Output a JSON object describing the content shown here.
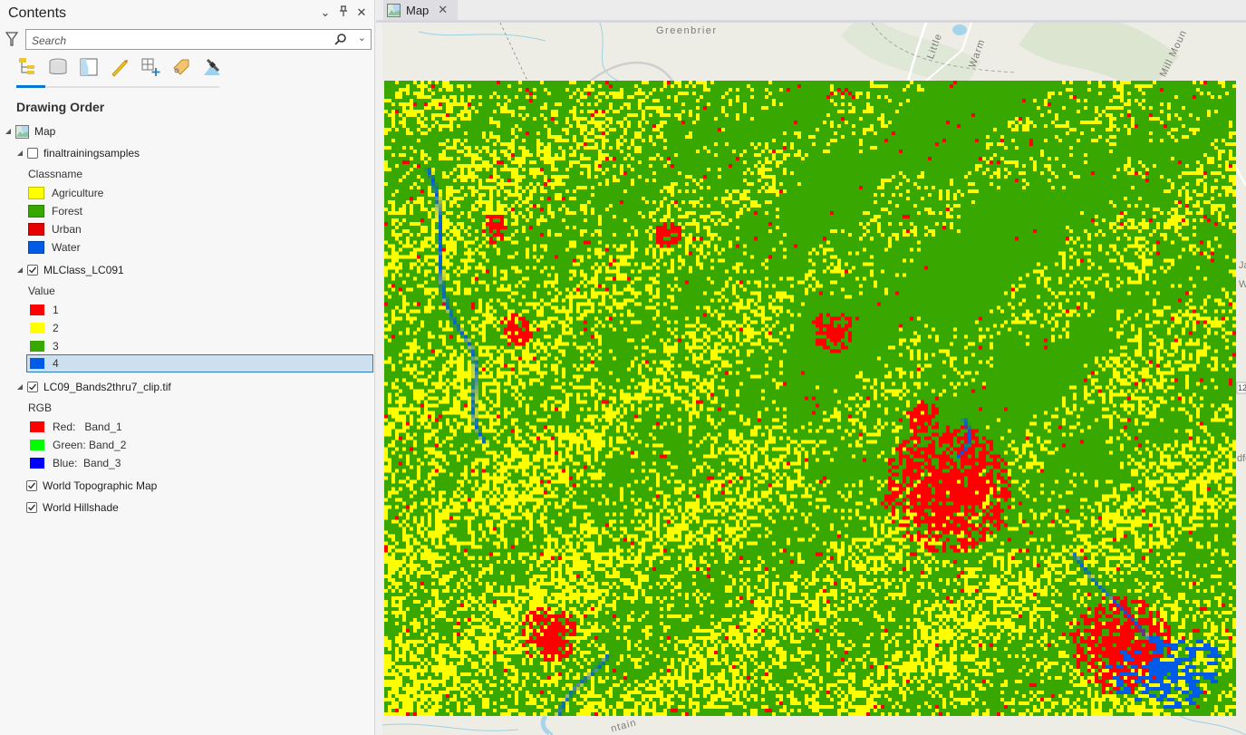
{
  "contents_pane": {
    "title": "Contents",
    "search": {
      "placeholder": "Search",
      "value": ""
    },
    "toolbar": [
      {
        "name": "list-by-drawing-order-icon",
        "active": true
      },
      {
        "name": "list-by-data-source-icon",
        "active": false
      },
      {
        "name": "list-by-selection-icon",
        "active": false
      },
      {
        "name": "list-by-editing-icon",
        "active": false
      },
      {
        "name": "list-by-snapping-icon",
        "active": false
      },
      {
        "name": "list-by-labeling-icon",
        "active": false
      },
      {
        "name": "list-by-perspective-imagery-icon",
        "active": false
      }
    ],
    "section_heading": "Drawing Order",
    "map_node": {
      "label": "Map"
    },
    "layers": [
      {
        "label": "finaltrainingsamples",
        "checked": false,
        "legend_heading": "Classname",
        "legend": [
          {
            "label": "Agriculture",
            "color": "#ffff00"
          },
          {
            "label": "Forest",
            "color": "#38a800"
          },
          {
            "label": "Urban",
            "color": "#e60000"
          },
          {
            "label": "Water",
            "color": "#005ce6"
          }
        ]
      },
      {
        "label": "MLClass_LC091",
        "checked": true,
        "legend_heading": "Value",
        "legend": [
          {
            "label": "1",
            "color": "#ff0000"
          },
          {
            "label": "2",
            "color": "#ffff00"
          },
          {
            "label": "3",
            "color": "#38a800"
          },
          {
            "label": "4",
            "color": "#005ce6",
            "selected": true
          }
        ]
      },
      {
        "label": "LC09_Bands2thru7_clip.tif",
        "checked": true,
        "legend_heading": "RGB",
        "legend": [
          {
            "label": "Red:   Band_1",
            "color": "#ff0000"
          },
          {
            "label": "Green: Band_2",
            "color": "#00ff00"
          },
          {
            "label": "Blue:  Band_3",
            "color": "#0000ff"
          }
        ]
      },
      {
        "label": "World Topographic Map",
        "checked": true
      },
      {
        "label": "World Hillshade",
        "checked": true
      }
    ]
  },
  "map_view": {
    "tab_label": "Map",
    "place_labels": [
      "Greenbrier",
      "Little",
      "Warm",
      "Mill Moun",
      "Ja",
      "W",
      "12",
      "dfo",
      "ntain"
    ],
    "class_colors": {
      "urban": "#ff0000",
      "agriculture": "#ffff00",
      "forest": "#38a800",
      "water": "#005ce6"
    }
  }
}
